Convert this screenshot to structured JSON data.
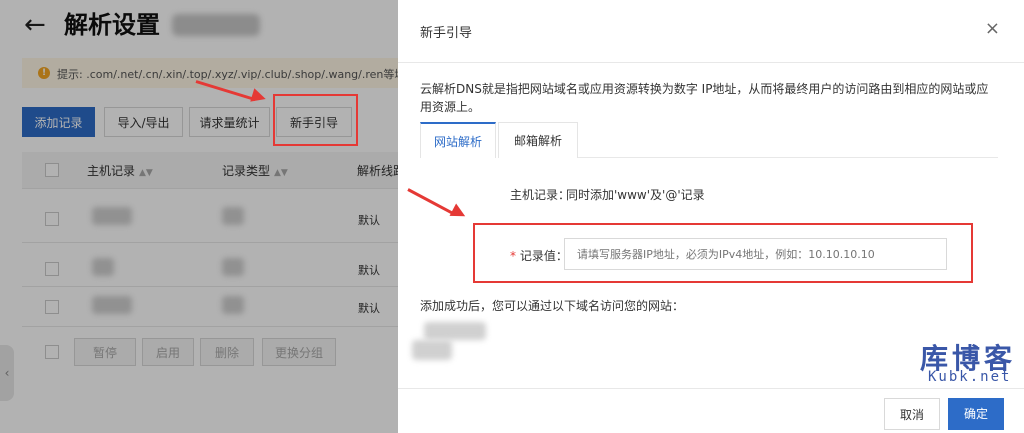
{
  "page": {
    "title": "解析设置",
    "tip": "提示: .com/.net/.cn/.xin/.top/.xyz/.vip/.club/.shop/.wang/.ren等域名",
    "toolbar": {
      "add": "添加记录",
      "import_export": "导入/导出",
      "stats": "请求量统计",
      "guide": "新手引导"
    },
    "table": {
      "headers": [
        "主机记录",
        "记录类型",
        "解析线路"
      ],
      "rows": [
        {
          "line": "默认"
        },
        {
          "line": "默认"
        },
        {
          "line": "默认"
        }
      ]
    },
    "bulk": {
      "pause": "暂停",
      "enable": "启用",
      "delete": "删除",
      "group": "更换分组"
    }
  },
  "modal": {
    "title": "新手引导",
    "close": "×",
    "description": "云解析DNS就是指把网站域名或应用资源转换为数字 IP地址，从而将最终用户的访问路由到相应的网站或应用资源上。",
    "tabs": [
      "网站解析",
      "邮箱解析"
    ],
    "active_tab": "网站解析",
    "host_label": "主机记录：",
    "host_value": "同时添加'www'及'@'记录",
    "record_required": "*",
    "record_label": "记录值：",
    "record_placeholder": "请填写服务器IP地址，必须为IPv4地址，例如：10.10.10.10",
    "success_text": "添加成功后，您可以通过以下域名访问您的网站：",
    "cancel": "取消",
    "confirm": "确定"
  },
  "watermark": {
    "cn": "库博客",
    "en": "Kubk.net"
  },
  "colors": {
    "primary": "#2d6cc8",
    "annotation": "#e53935",
    "watermark": "#3a57a8"
  }
}
